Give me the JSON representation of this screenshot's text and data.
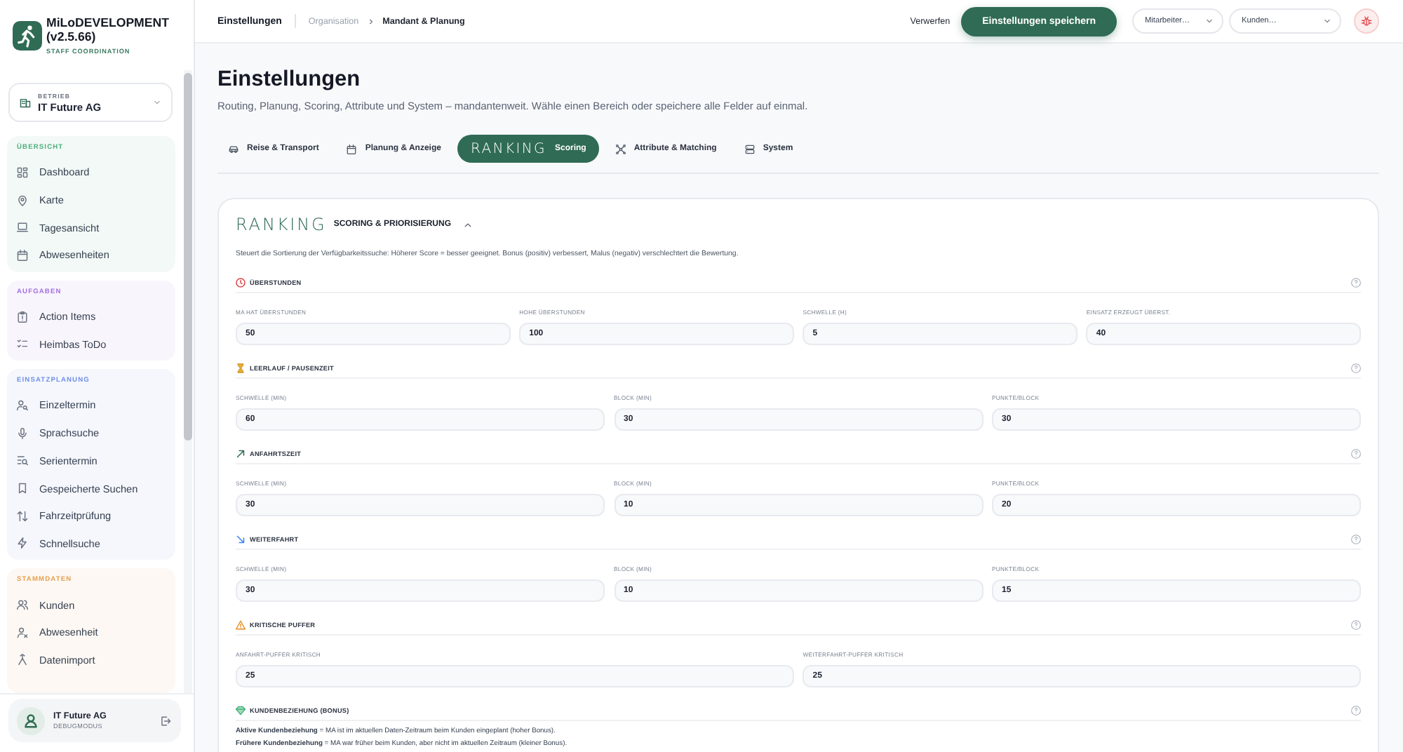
{
  "sidebar": {
    "brand": {
      "title": "MiLoDEVELOPMENT (v2.5.66)",
      "subtitle": "STAFF COORDINATION"
    },
    "tenant": {
      "label": "BETRIEB",
      "value": "IT Future AG"
    },
    "groups": [
      {
        "title": "ÜBERSICHT",
        "color": "#4cae7c",
        "items": [
          {
            "label": "Dashboard"
          },
          {
            "label": "Karte"
          },
          {
            "label": "Tagesansicht"
          },
          {
            "label": "Abwesenheiten"
          }
        ]
      },
      {
        "title": "AUFGABEN",
        "color": "#a46ee0",
        "items": [
          {
            "label": "Action Items"
          },
          {
            "label": "Heimbas ToDo"
          }
        ]
      },
      {
        "title": "EINSATZPLANUNG",
        "color": "#6f8fe6",
        "items": [
          {
            "label": "Einzeltermin"
          },
          {
            "label": "Sprachsuche"
          },
          {
            "label": "Serientermin"
          },
          {
            "label": "Gespeicherte Suchen"
          },
          {
            "label": "Fahrzeitprüfung"
          },
          {
            "label": "Schnellsuche"
          }
        ]
      },
      {
        "title": "STAMMDATEN",
        "color": "#e6a04e",
        "items": [
          {
            "label": "Kunden"
          },
          {
            "label": "Abwesenheit"
          },
          {
            "label": "Datenimport"
          }
        ]
      }
    ],
    "user": {
      "name": "IT Future AG",
      "role": "DEBUGMODUS"
    }
  },
  "header": {
    "breadcrumb": {
      "page": "Einstellungen",
      "parent": "Organisation",
      "current": "Mandant & Planung"
    },
    "discard": "Verwerfen",
    "save": "Einstellungen speichern",
    "filters": [
      {
        "placeholder": "Mitarbeiter…"
      },
      {
        "placeholder": "Kunden…"
      }
    ]
  },
  "page": {
    "title": "Einstellungen",
    "subtitle": "Routing, Planung, Scoring, Attribute und System – mandantenweit. Wähle einen Bereich oder speichere alle Felder auf einmal."
  },
  "tabs": [
    {
      "label": "Reise & Transport",
      "selected": false
    },
    {
      "label": "Planung & Anzeige",
      "selected": false
    },
    {
      "wordmark": "RANKING",
      "label": "Scoring",
      "selected": true
    },
    {
      "label": "Attribute & Matching",
      "selected": false
    },
    {
      "label": "System",
      "selected": false
    }
  ],
  "card": {
    "wordmark": "RANKING",
    "title": "SCORING & PRIORISIERUNG",
    "expanded": true,
    "description": "Steuert die Sortierung der Verfügbarkeitssuche: Höherer Score = besser geeignet. Bonus (positiv) verbessert, Malus (negativ) verschlechtert die Bewertung.",
    "sections": [
      {
        "title": "ÜBERSTUNDEN",
        "fields": [
          {
            "label": "MA HAT ÜBERSTUNDEN",
            "value": "50"
          },
          {
            "label": "HOHE ÜBERSTUNDEN",
            "value": "100"
          },
          {
            "label": "SCHWELLE (H)",
            "value": "5"
          },
          {
            "label": "EINSATZ ERZEUGT ÜBERST.",
            "value": "40"
          }
        ]
      },
      {
        "title": "LEERLAUF / PAUSENZEIT",
        "fields": [
          {
            "label": "SCHWELLE (MIN)",
            "value": "60"
          },
          {
            "label": "BLOCK (MIN)",
            "value": "30"
          },
          {
            "label": "PUNKTE/BLOCK",
            "value": "30"
          }
        ]
      },
      {
        "title": "ANFAHRTSZEIT",
        "fields": [
          {
            "label": "SCHWELLE (MIN)",
            "value": "30"
          },
          {
            "label": "BLOCK (MIN)",
            "value": "10"
          },
          {
            "label": "PUNKTE/BLOCK",
            "value": "20"
          }
        ]
      },
      {
        "title": "WEITERFAHRT",
        "fields": [
          {
            "label": "SCHWELLE (MIN)",
            "value": "30"
          },
          {
            "label": "BLOCK (MIN)",
            "value": "10"
          },
          {
            "label": "PUNKTE/BLOCK",
            "value": "15"
          }
        ]
      },
      {
        "title": "KRITISCHE PUFFER",
        "fields": [
          {
            "label": "ANFAHRT-PUFFER KRITISCH",
            "value": "25"
          },
          {
            "label": "WEITERFAHRT-PUFFER KRITISCH",
            "value": "25"
          }
        ]
      },
      {
        "title": "KUNDENBEZIEHUNG (BONUS)",
        "notes": [
          "**Aktive Kundenbeziehung** = MA ist im aktuellen Daten-Zeitraum beim Kunden eingeplant (hoher Bonus).",
          "**Frühere Kundenbeziehung** = MA war früher beim Kunden, aber nicht im aktuellen Zeitraum (kleiner Bonus)."
        ]
      }
    ]
  }
}
